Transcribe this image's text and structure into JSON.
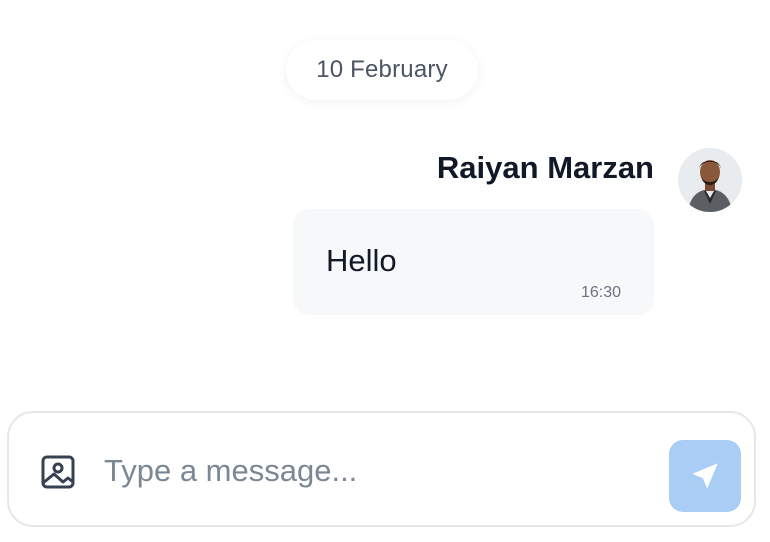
{
  "chat": {
    "date_label": "10 February",
    "messages": [
      {
        "sender": "Raiyan Marzan",
        "text": "Hello",
        "time": "16:30"
      }
    ]
  },
  "composer": {
    "placeholder": "Type a message...",
    "value": "",
    "attach_icon": "image-icon",
    "send_icon": "send-icon"
  },
  "colors": {
    "send_button": "#a9cdf5",
    "bubble_bg": "#f7f8fa",
    "muted_text": "#6b7280"
  }
}
